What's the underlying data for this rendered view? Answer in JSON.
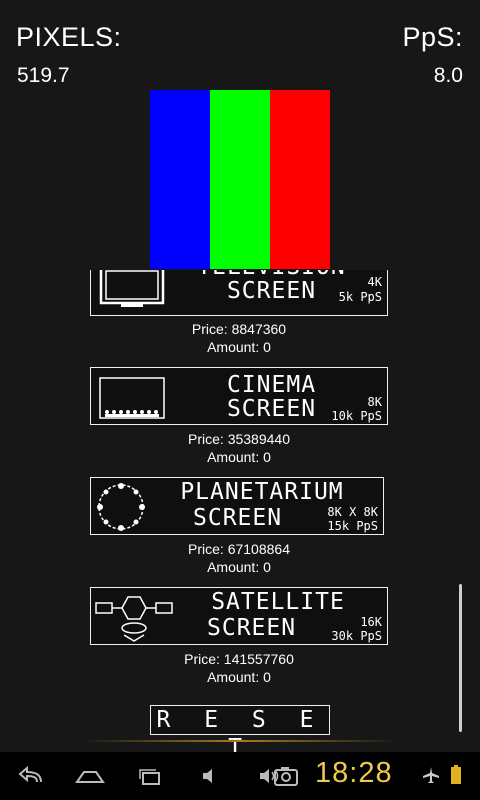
{
  "stats": {
    "pixels_label": "PIXELS:",
    "pixels_value": "519.7",
    "pps_label": "PpS:",
    "pps_value": "8.0"
  },
  "clicker": {
    "colors": [
      "#0000ff",
      "#00ff00",
      "#ff0000"
    ],
    "icon": "rgb-clicker-block"
  },
  "shop": {
    "items": [
      {
        "title_line1": "TELEVISION",
        "title_line2": "SCREEN",
        "resolution": "4K",
        "rate": "5k PpS",
        "price_label": "Price: 8847360",
        "amount_label": "Amount: 0",
        "icon": "television-icon"
      },
      {
        "title_line1": "CINEMA",
        "title_line2": "SCREEN",
        "resolution": "8K",
        "rate": "10k PpS",
        "price_label": "Price: 35389440",
        "amount_label": "Amount: 0",
        "icon": "cinema-icon"
      },
      {
        "title_line1": "PLANETARIUM",
        "title_line2": "SCREEN",
        "resolution": "8K X 8K",
        "rate": "15k PpS",
        "price_label": "Price: 67108864",
        "amount_label": "Amount: 0",
        "icon": "planetarium-icon"
      },
      {
        "title_line1": "SATELLITE",
        "title_line2": "SCREEN",
        "resolution": "16K",
        "rate": "30k PpS",
        "price_label": "Price: 141557760",
        "amount_label": "Amount: 0",
        "icon": "satellite-icon"
      }
    ]
  },
  "reset_label": "R E S E T",
  "status_bar": {
    "time": "18:28",
    "clock_color": "#f0c84a"
  }
}
